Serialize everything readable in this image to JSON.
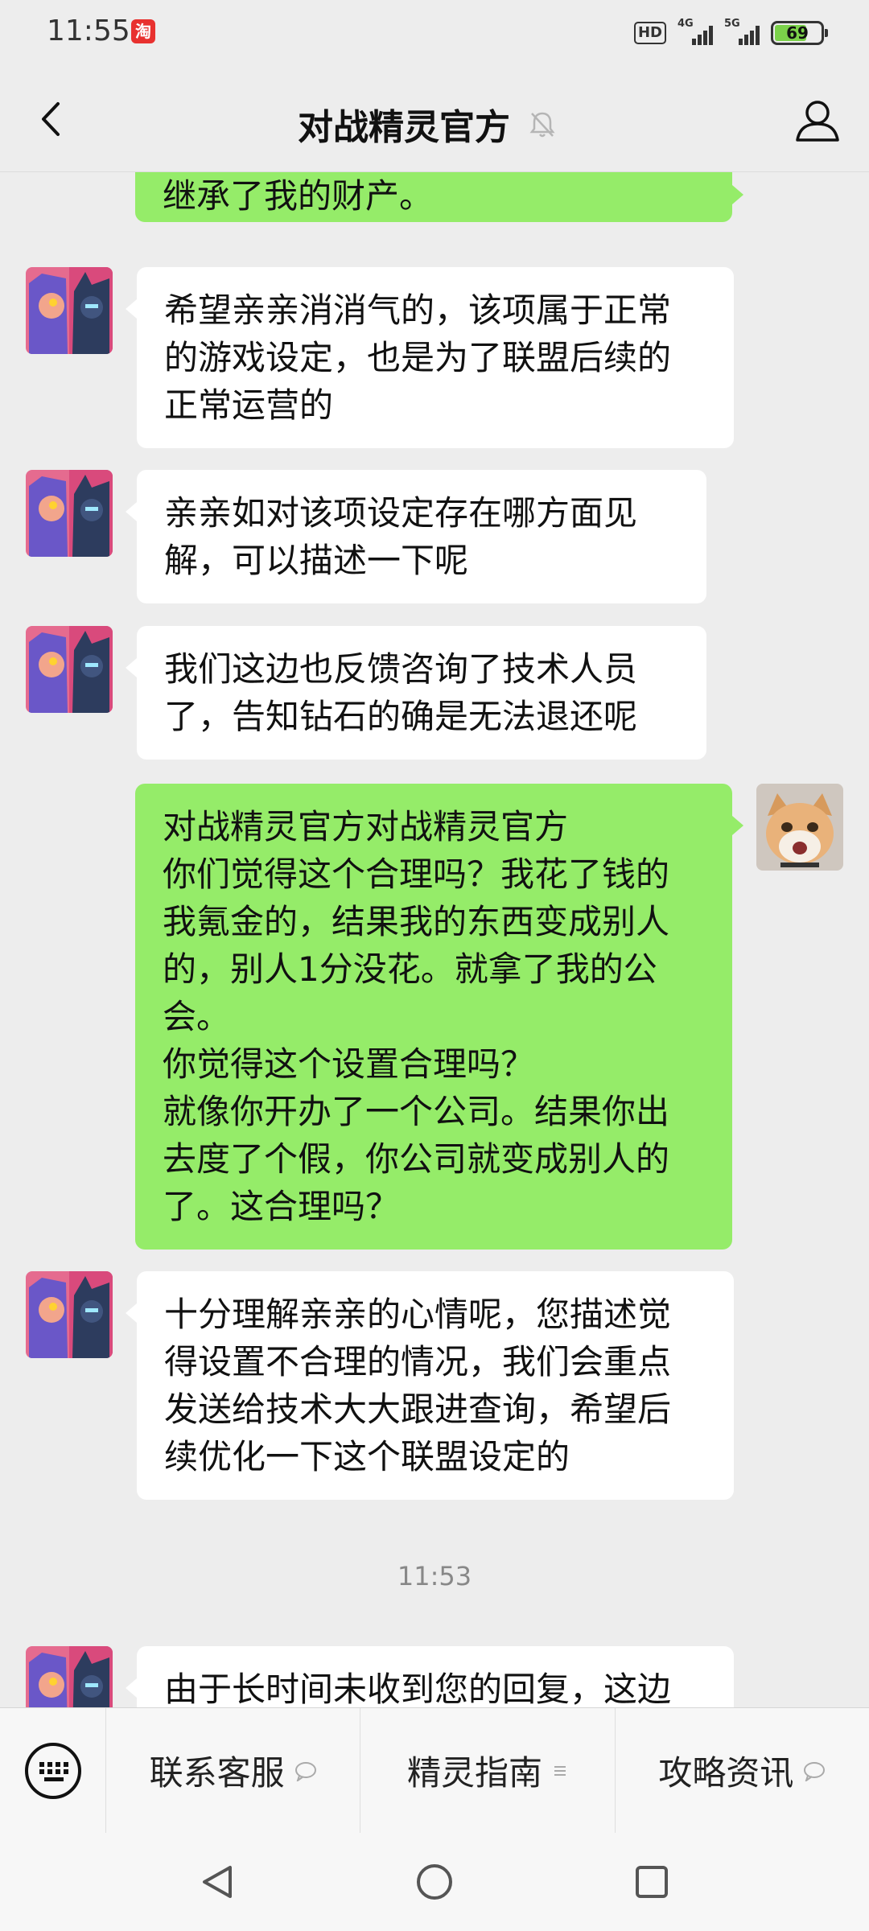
{
  "status_bar": {
    "time": "11:55",
    "app_badge": "淘",
    "hd": "HD",
    "network1": "4G",
    "network2": "5G",
    "battery": "69"
  },
  "header": {
    "title": "对战精灵官方"
  },
  "messages": [
    {
      "side": "out",
      "text": "继承了我的财产。"
    },
    {
      "side": "in",
      "text": "希望亲亲消消气的，该项属于正常\n的游戏设定，也是为了联盟后续的\n正常运营的"
    },
    {
      "side": "in",
      "text": "亲亲如对该项设定存在哪方面见\n解，可以描述一下呢"
    },
    {
      "side": "in",
      "text": "我们这边也反馈咨询了技术人员\n了，告知钻石的确是无法退还呢"
    },
    {
      "side": "out",
      "text": "对战精灵官方对战精灵官方\n你们觉得这个合理吗？我花了钱的\n我氪金的，结果我的东西变成别人\n的，别人1分没花。就拿了我的公\n会。\n你觉得这个设置合理吗？\n就像你开办了一个公司。结果你出\n去度了个假，你公司就变成别人的\n了。这合理吗？"
    },
    {
      "side": "in",
      "text": "十分理解亲亲的心情呢，您描述觉\n得设置不合理的情况，我们会重点\n发送给技术大大跟进查询，希望后\n续优化一下这个联盟设定的"
    },
    {
      "side": "in",
      "text": "由于长时间未收到您的回复，这边"
    }
  ],
  "timestamp": "11:53",
  "menu": {
    "items": [
      {
        "label": "联系客服",
        "glyph": "speech-bubble-icon"
      },
      {
        "label": "精灵指南",
        "glyph": "list-icon"
      },
      {
        "label": "攻略资讯",
        "glyph": "speech-bubble-icon"
      }
    ]
  },
  "colors": {
    "background": "#ededed",
    "bubble_out": "#95ec69",
    "bubble_in": "#ffffff",
    "battery_fill": "#7bd14a"
  }
}
